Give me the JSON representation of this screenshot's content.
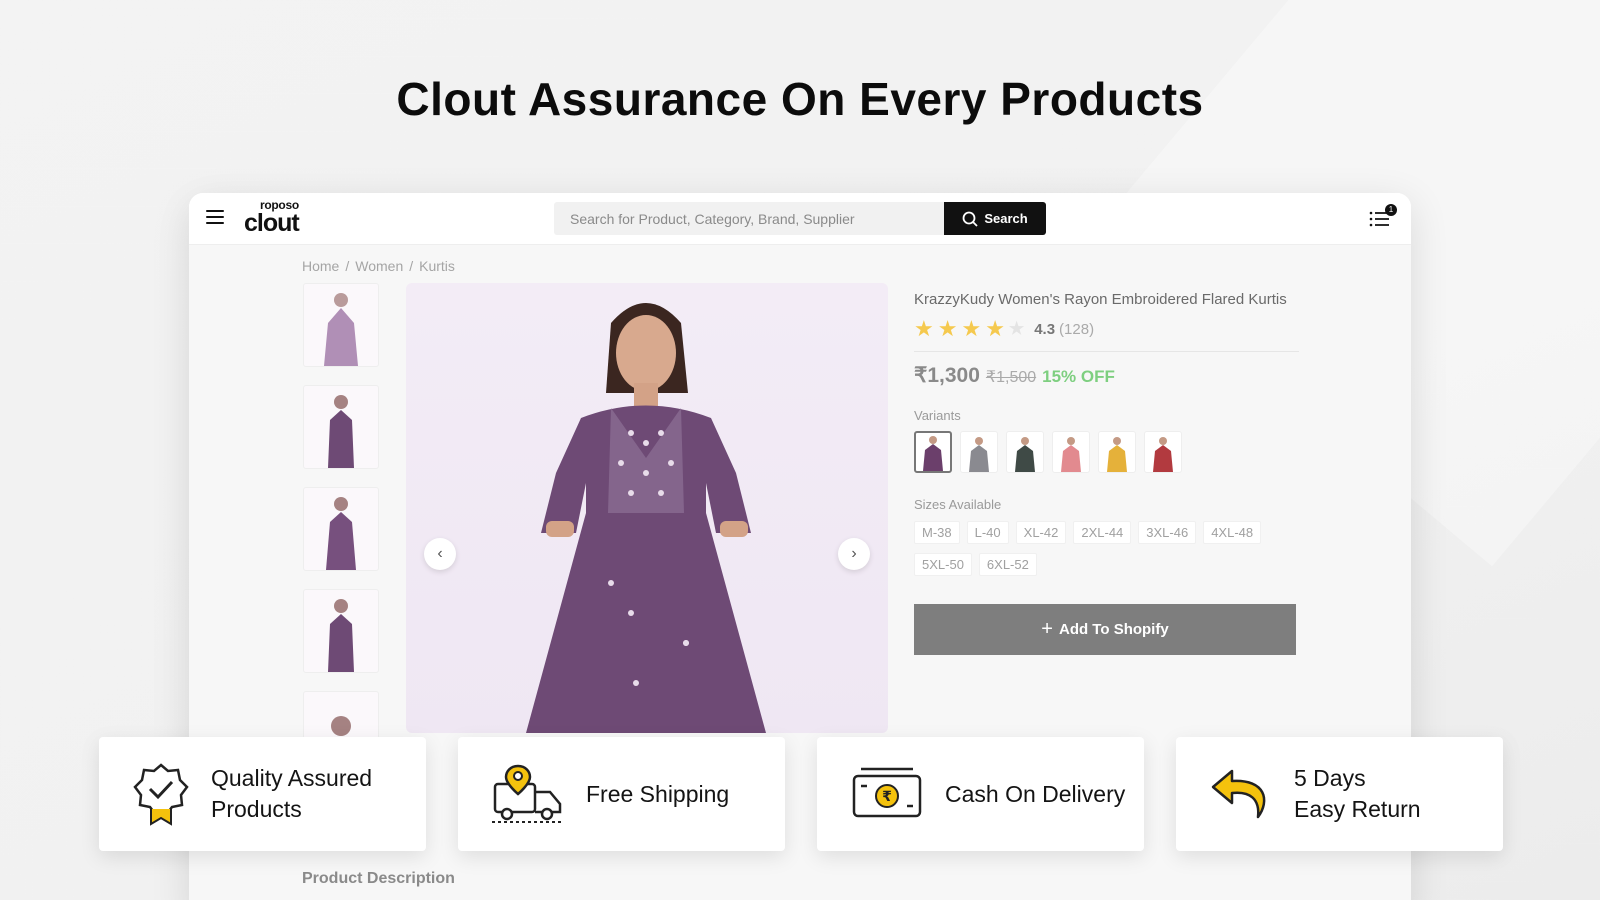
{
  "headline": "Clout Assurance On Every Products",
  "app": {
    "logo_small": "roposo",
    "logo_main": "clout",
    "search": {
      "placeholder": "Search for Product, Category, Brand, Supplier",
      "button_label": "Search"
    },
    "cart_count": "1"
  },
  "breadcrumb": [
    "Home",
    "Women",
    "Kurtis"
  ],
  "product": {
    "title": "KrazzyKudy Women's Rayon Embroidered Flared Kurtis",
    "rating": "4.3",
    "rating_count": "(128)",
    "rating_stars": 4.3,
    "price": "₹1,300",
    "mrp": "₹1,500",
    "discount": "15% OFF",
    "variants_label": "Variants",
    "variant_colors": [
      "#6b3f6b",
      "#8a8a90",
      "#3f4a46",
      "#e28a8f",
      "#e5b13a",
      "#b23a3f"
    ],
    "sizes_label": "Sizes Available",
    "sizes": [
      "M-38",
      "L-40",
      "XL-42",
      "2XL-44",
      "3XL-46",
      "4XL-48",
      "5XL-50",
      "6XL-52"
    ],
    "add_button": "Add To Shopify",
    "accent_purple": "#6e4a75"
  },
  "section_title": "Product Description",
  "features": [
    {
      "label": "Quality Assured\nProducts",
      "icon": "quality-badge-icon"
    },
    {
      "label": "Free Shipping",
      "icon": "delivery-truck-icon"
    },
    {
      "label": "Cash On Delivery",
      "icon": "cash-rupee-icon"
    },
    {
      "label": "5 Days\nEasy Return",
      "icon": "return-arrow-icon"
    }
  ]
}
